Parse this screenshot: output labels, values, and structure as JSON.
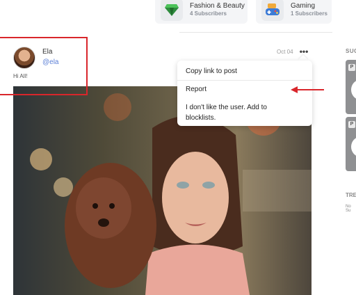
{
  "categories": [
    {
      "name": "Fashion & Beauty",
      "subscribers": "4 Subscribers",
      "icon": "gem-icon"
    },
    {
      "name": "Gaming",
      "subscribers": "1 Subscribers",
      "icon": "gamepad-icon"
    }
  ],
  "post": {
    "author_name": "Ela",
    "author_handle": "@ela",
    "text": "Hi All!",
    "date": "Oct 04",
    "more_icon": "more-horizontal-icon"
  },
  "menu": {
    "items": [
      {
        "label": "Copy link to post"
      },
      {
        "label": "Report"
      },
      {
        "label": "I don't like the user. Add to blocklists."
      }
    ]
  },
  "sidebar": {
    "suggestions_title": "SUG",
    "badge": "P",
    "trending_title": "TRE",
    "trending_empty": "No Su"
  },
  "annotation_colors": {
    "highlight": "#d9262b",
    "arrow": "#d9262b"
  }
}
